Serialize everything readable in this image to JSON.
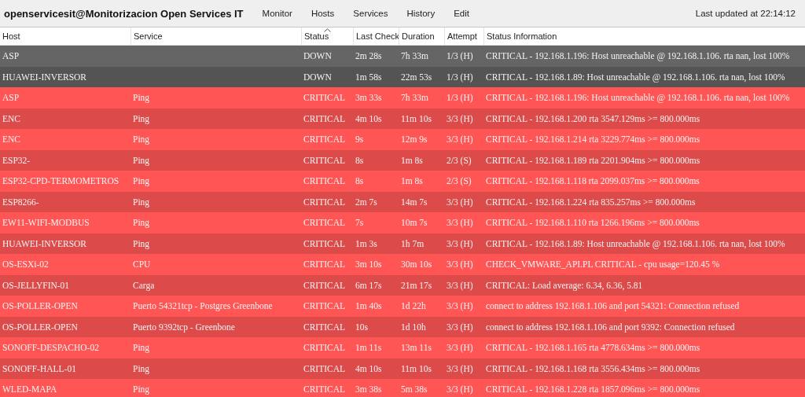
{
  "header": {
    "title": "openservicesit@Monitorizacion Open Services IT",
    "menu": [
      "Monitor",
      "Hosts",
      "Services",
      "History",
      "Edit"
    ],
    "updated": "Last updated at 22:14:12"
  },
  "columns": [
    {
      "label": "Host",
      "sorted": false
    },
    {
      "label": "Service",
      "sorted": false
    },
    {
      "label": "Status",
      "sorted": true
    },
    {
      "label": "Last Check",
      "sorted": false
    },
    {
      "label": "Duration",
      "sorted": false
    },
    {
      "label": "Attempt",
      "sorted": false
    },
    {
      "label": "Status Information",
      "sorted": false
    }
  ],
  "rows": [
    {
      "kind": "down",
      "host": "ASP",
      "service": "",
      "status": "DOWN",
      "last_check": "2m 28s",
      "duration": "7h 33m",
      "attempt": "1/3 (H)",
      "info": "CRITICAL - 192.168.1.196: Host unreachable @ 192.168.1.106. rta nan, lost 100%"
    },
    {
      "kind": "down",
      "host": "HUAWEI-INVERSOR",
      "service": "",
      "status": "DOWN",
      "last_check": "1m 58s",
      "duration": "22m 53s",
      "attempt": "1/3 (H)",
      "info": "CRITICAL - 192.168.1.89: Host unreachable @ 192.168.1.106. rta nan, lost 100%"
    },
    {
      "kind": "critical",
      "host": "ASP",
      "service": "Ping",
      "status": "CRITICAL",
      "last_check": "3m 33s",
      "duration": "7h 33m",
      "attempt": "1/3 (H)",
      "info": "CRITICAL - 192.168.1.196: Host unreachable @ 192.168.1.106. rta nan, lost 100%"
    },
    {
      "kind": "critical",
      "host": "ENC",
      "service": "Ping",
      "status": "CRITICAL",
      "last_check": "4m 10s",
      "duration": "11m 10s",
      "attempt": "3/3 (H)",
      "info": "CRITICAL - 192.168.1.200 rta 3547.129ms >= 800.000ms"
    },
    {
      "kind": "critical",
      "host": "ENC",
      "service": "Ping",
      "status": "CRITICAL",
      "last_check": "9s",
      "duration": "12m 9s",
      "attempt": "3/3 (H)",
      "info": "CRITICAL - 192.168.1.214 rta 3229.774ms >= 800.000ms"
    },
    {
      "kind": "critical",
      "host": "ESP32-",
      "service": "Ping",
      "status": "CRITICAL",
      "last_check": "8s",
      "duration": "1m 8s",
      "attempt": "2/3 (S)",
      "info": "CRITICAL - 192.168.1.189 rta 2201.904ms >= 800.000ms"
    },
    {
      "kind": "critical",
      "host": "ESP32-CPD-TERMOMETROS",
      "service": "Ping",
      "status": "CRITICAL",
      "last_check": "8s",
      "duration": "1m 8s",
      "attempt": "2/3 (S)",
      "info": "CRITICAL - 192.168.1.118 rta 2099.037ms >= 800.000ms"
    },
    {
      "kind": "critical",
      "host": "ESP8266-",
      "service": "Ping",
      "status": "CRITICAL",
      "last_check": "2m 7s",
      "duration": "14m 7s",
      "attempt": "3/3 (H)",
      "info": "CRITICAL - 192.168.1.224 rta 835.257ms >= 800.000ms"
    },
    {
      "kind": "critical",
      "host": "EW11-WIFI-MODBUS",
      "service": "Ping",
      "status": "CRITICAL",
      "last_check": "7s",
      "duration": "10m 7s",
      "attempt": "3/3 (H)",
      "info": "CRITICAL - 192.168.1.110 rta 1266.196ms >= 800.000ms"
    },
    {
      "kind": "critical",
      "host": "HUAWEI-INVERSOR",
      "service": "Ping",
      "status": "CRITICAL",
      "last_check": "1m 3s",
      "duration": "1h 7m",
      "attempt": "3/3 (H)",
      "info": "CRITICAL - 192.168.1.89: Host unreachable @ 192.168.1.106. rta nan, lost 100%"
    },
    {
      "kind": "critical",
      "host": "OS-ESXi-02",
      "service": "CPU",
      "status": "CRITICAL",
      "last_check": "3m 10s",
      "duration": "30m 10s",
      "attempt": "3/3 (H)",
      "info": "CHECK_VMWARE_API.PL CRITICAL - cpu usage=120.45 %"
    },
    {
      "kind": "critical",
      "host": "OS-JELLYFIN-01",
      "service": "Carga",
      "status": "CRITICAL",
      "last_check": "6m 17s",
      "duration": "21m 17s",
      "attempt": "3/3 (H)",
      "info": "CRITICAL: Load average: 6.34, 6.36, 5.81"
    },
    {
      "kind": "critical",
      "host": "OS-POLLER-OPEN",
      "service": "Puerto 54321tcp - Postgres Greenbone",
      "status": "CRITICAL",
      "last_check": "1m 40s",
      "duration": "1d 22h",
      "attempt": "3/3 (H)",
      "info": "connect to address 192.168.1.106 and port 54321: Connection refused"
    },
    {
      "kind": "critical",
      "host": "OS-POLLER-OPEN",
      "service": "Puerto 9392tcp - Greenbone",
      "status": "CRITICAL",
      "last_check": "10s",
      "duration": "1d 10h",
      "attempt": "3/3 (H)",
      "info": "connect to address 192.168.1.106 and port 9392: Connection refused"
    },
    {
      "kind": "critical",
      "host": "SONOFF-DESPACHO-02",
      "service": "Ping",
      "status": "CRITICAL",
      "last_check": "1m 11s",
      "duration": "13m 11s",
      "attempt": "3/3 (H)",
      "info": "CRITICAL - 192.168.1.165 rta 4778.634ms >= 800.000ms"
    },
    {
      "kind": "critical",
      "host": "SONOFF-HALL-01",
      "service": "Ping",
      "status": "CRITICAL",
      "last_check": "4m 10s",
      "duration": "11m 10s",
      "attempt": "3/3 (H)",
      "info": "CRITICAL - 192.168.1.168 rta 3556.434ms >= 800.000ms"
    },
    {
      "kind": "critical",
      "host": "WLED-MAPA",
      "service": "Ping",
      "status": "CRITICAL",
      "last_check": "3m 38s",
      "duration": "5m 38s",
      "attempt": "3/3 (H)",
      "info": "CRITICAL - 192.168.1.228 rta 1857.096ms >= 800.000ms"
    }
  ]
}
